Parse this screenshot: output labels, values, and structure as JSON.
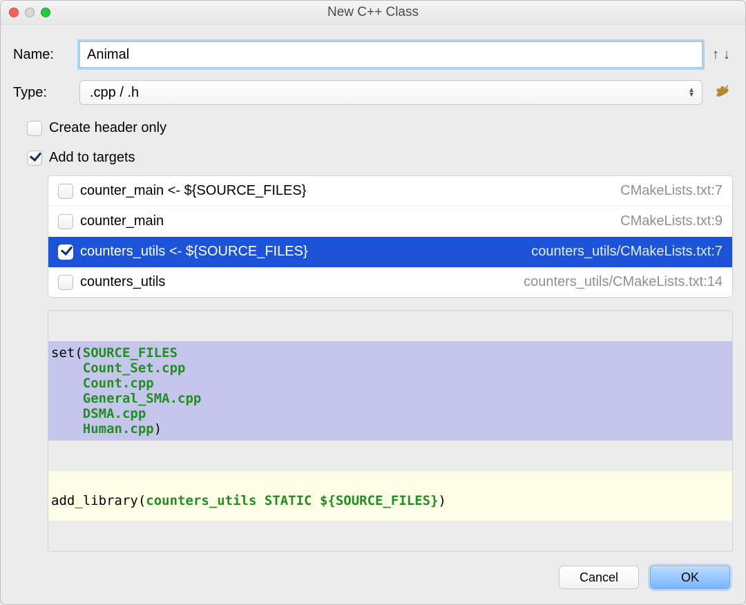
{
  "window": {
    "title": "New C++ Class"
  },
  "fields": {
    "name_label": "Name:",
    "name_value": "Animal",
    "type_label": "Type:",
    "type_selected": ".cpp / .h"
  },
  "options": {
    "create_header_only_label": "Create header only",
    "create_header_only_checked": false,
    "add_to_targets_label": "Add to targets",
    "add_to_targets_checked": true
  },
  "targets": [
    {
      "label": "counter_main <- ${SOURCE_FILES}",
      "path": "CMakeLists.txt:7",
      "checked": false,
      "selected": false
    },
    {
      "label": "counter_main",
      "path": "CMakeLists.txt:9",
      "checked": false,
      "selected": false
    },
    {
      "label": "counters_utils <- ${SOURCE_FILES}",
      "path": "counters_utils/CMakeLists.txt:7",
      "checked": true,
      "selected": true
    },
    {
      "label": "counters_utils",
      "path": "counters_utils/CMakeLists.txt:14",
      "checked": false,
      "selected": false
    }
  ],
  "code": {
    "block_a_tokens": [
      {
        "t": "plain",
        "v": "set("
      },
      {
        "t": "green",
        "v": "SOURCE_FILES"
      },
      {
        "t": "plain",
        "v": "\n    "
      },
      {
        "t": "green",
        "v": "Count_Set.cpp"
      },
      {
        "t": "plain",
        "v": "\n    "
      },
      {
        "t": "green",
        "v": "Count.cpp"
      },
      {
        "t": "plain",
        "v": "\n    "
      },
      {
        "t": "green",
        "v": "General_SMA.cpp"
      },
      {
        "t": "plain",
        "v": "\n    "
      },
      {
        "t": "green",
        "v": "DSMA.cpp"
      },
      {
        "t": "plain",
        "v": "\n    "
      },
      {
        "t": "green",
        "v": "Human.cpp"
      },
      {
        "t": "plain",
        "v": ")"
      }
    ],
    "block_b_tokens": [
      {
        "t": "plain",
        "v": "\nadd_library("
      },
      {
        "t": "green",
        "v": "counters_utils STATIC ${SOURCE_FILES}"
      },
      {
        "t": "plain",
        "v": ")"
      }
    ]
  },
  "buttons": {
    "cancel": "Cancel",
    "ok": "OK"
  }
}
